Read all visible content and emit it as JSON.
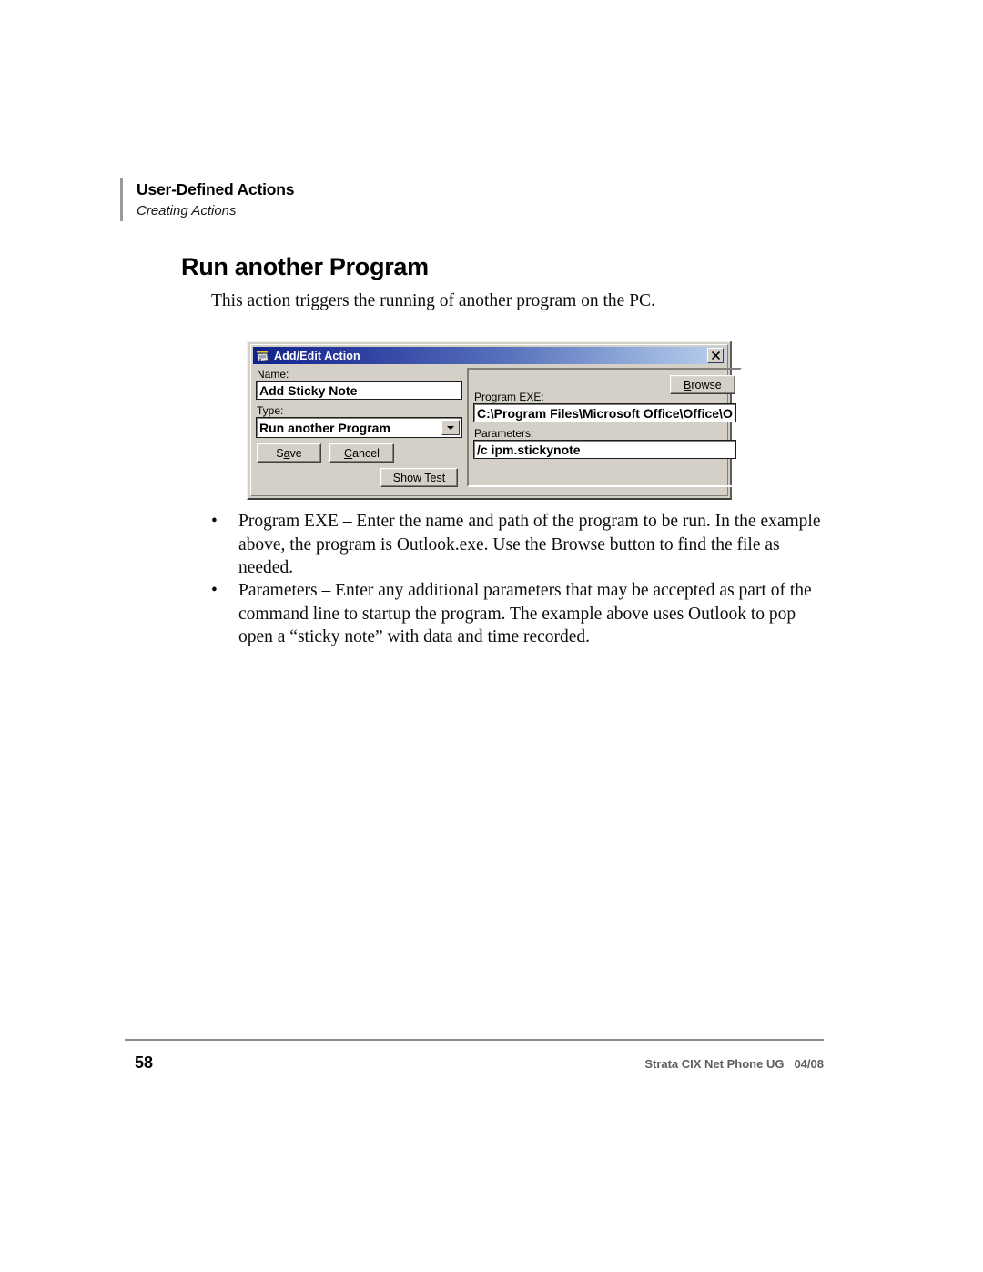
{
  "header": {
    "title": "User-Defined Actions",
    "subtitle": "Creating Actions"
  },
  "section": {
    "heading": "Run another Program",
    "intro": "This action triggers the running of another program on the PC."
  },
  "dialog": {
    "titlebar": {
      "title": "Add/Edit Action",
      "icon": "phone-device-icon",
      "close_label": "×"
    },
    "name_label": "Name:",
    "name_value": "Add Sticky Note",
    "type_label": "Type:",
    "type_value": "Run another Program",
    "type_options": [
      "Run another Program"
    ],
    "save_label_pre": "S",
    "save_label_key": "a",
    "save_label_post": "ve",
    "cancel_label_pre": "",
    "cancel_label_key": "C",
    "cancel_label_post": "ancel",
    "showtest_label_pre": "S",
    "showtest_label_key": "h",
    "showtest_label_post": "ow Test",
    "browse_label_pre": "",
    "browse_label_key": "B",
    "browse_label_post": "rowse",
    "program_exe_label": "Program EXE:",
    "program_exe_value": "C:\\Program Files\\Microsoft Office\\Office\\O",
    "parameters_label": "Parameters:",
    "parameters_value": "/c ipm.stickynote"
  },
  "bullets": [
    {
      "marker": "•",
      "text": "Program EXE – Enter the name and path of the program to be run.  In the example above, the program is Outlook.exe.  Use the Browse button to find the file as needed."
    },
    {
      "marker": "•",
      "text": "Parameters – Enter any additional parameters that may be accepted as part of the command line to startup the program.  The example above uses Outlook to pop open a “sticky note” with data and time recorded."
    }
  ],
  "footer": {
    "page_number": "58",
    "document": "Strata CIX Net Phone UG",
    "date": "04/08"
  },
  "colors": {
    "titlebar_start": "#10238c",
    "titlebar_end": "#bcd0ec",
    "dialog_face": "#d4d0c8",
    "header_rule": "#9a9a9a",
    "footer_text": "#5e5e5e"
  }
}
